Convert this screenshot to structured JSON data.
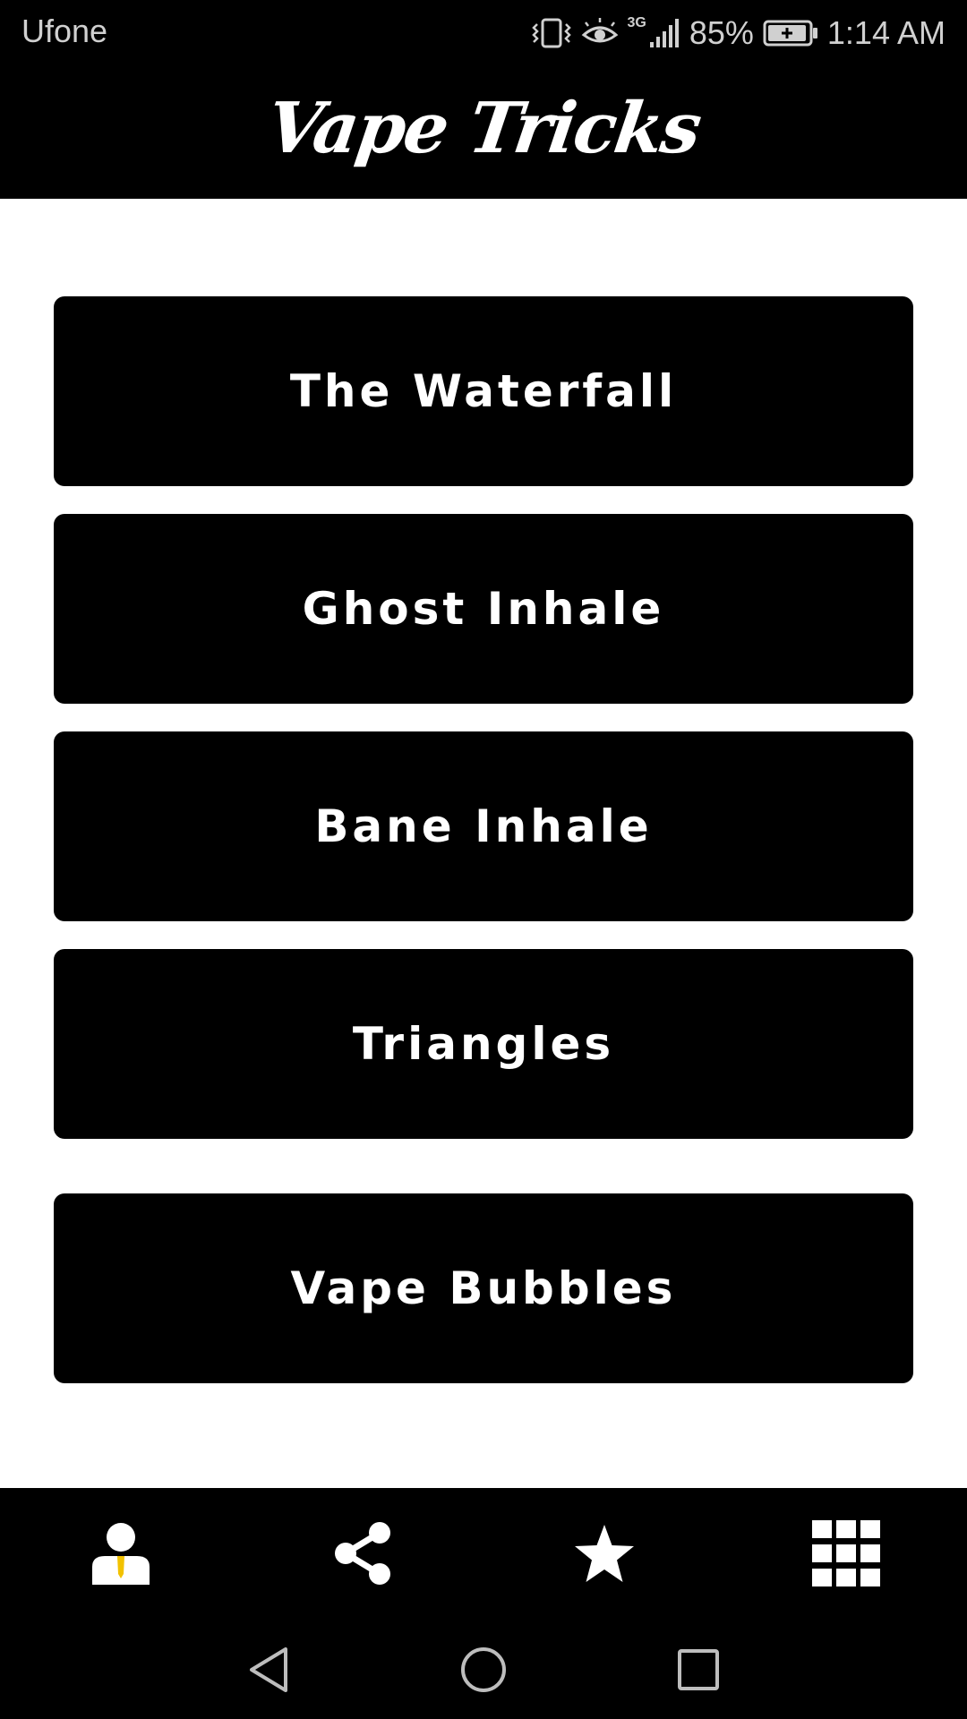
{
  "status_bar": {
    "carrier": "Ufone",
    "network": "3G",
    "battery_percent": "85%",
    "time": "1:14 AM"
  },
  "header": {
    "title": "Vape Tricks"
  },
  "tricks": [
    {
      "label": "The Waterfall"
    },
    {
      "label": "Ghost Inhale"
    },
    {
      "label": "Bane Inhale"
    },
    {
      "label": "Triangles"
    },
    {
      "label": "Vape Bubbles"
    }
  ],
  "tab_bar": {
    "items": [
      {
        "icon": "profile-icon"
      },
      {
        "icon": "share-icon"
      },
      {
        "icon": "star-icon"
      },
      {
        "icon": "grid-icon"
      }
    ]
  },
  "nav_bar": {
    "items": [
      {
        "icon": "back-icon"
      },
      {
        "icon": "home-icon"
      },
      {
        "icon": "recents-icon"
      }
    ]
  },
  "colors": {
    "background": "#000000",
    "content_bg": "#ffffff",
    "button_bg": "#000000",
    "button_text": "#ffffff",
    "accent_yellow": "#f2c200"
  }
}
